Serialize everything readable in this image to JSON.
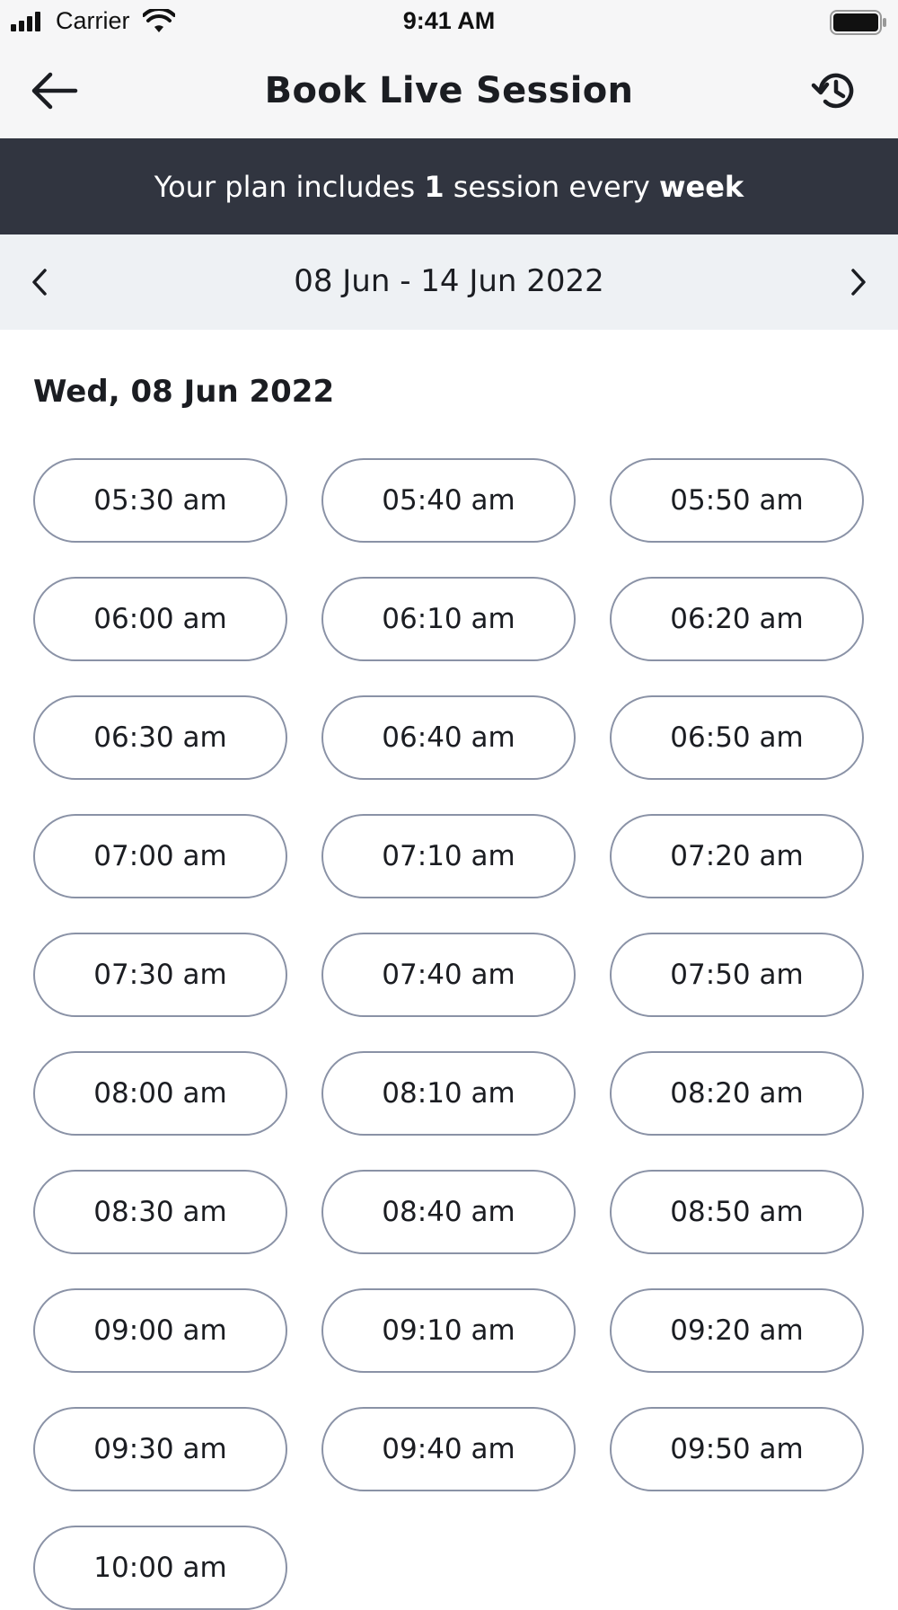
{
  "status_bar": {
    "carrier": "Carrier",
    "time": "9:41 AM"
  },
  "header": {
    "title": "Book Live Session",
    "back_icon": "arrow-left-icon",
    "history_icon": "history-icon"
  },
  "plan_banner": {
    "prefix": "Your plan includes ",
    "count": "1",
    "middle": " session every ",
    "period": "week"
  },
  "week_selector": {
    "range": "08 Jun - 14 Jun 2022",
    "prev_icon": "chevron-left-icon",
    "next_icon": "chevron-right-icon"
  },
  "day": {
    "heading": "Wed, 08 Jun 2022",
    "slots": [
      "05:30 am",
      "05:40 am",
      "05:50 am",
      "06:00 am",
      "06:10 am",
      "06:20 am",
      "06:30 am",
      "06:40 am",
      "06:50 am",
      "07:00 am",
      "07:10 am",
      "07:20 am",
      "07:30 am",
      "07:40 am",
      "07:50 am",
      "08:00 am",
      "08:10 am",
      "08:20 am",
      "08:30 am",
      "08:40 am",
      "08:50 am",
      "09:00 am",
      "09:10 am",
      "09:20 am",
      "09:30 am",
      "09:40 am",
      "09:50 am",
      "10:00 am"
    ]
  },
  "colors": {
    "banner_bg": "#313540",
    "week_bar_bg": "#eef1f4",
    "slot_border": "#8a92a6",
    "text": "#1b1d22"
  }
}
